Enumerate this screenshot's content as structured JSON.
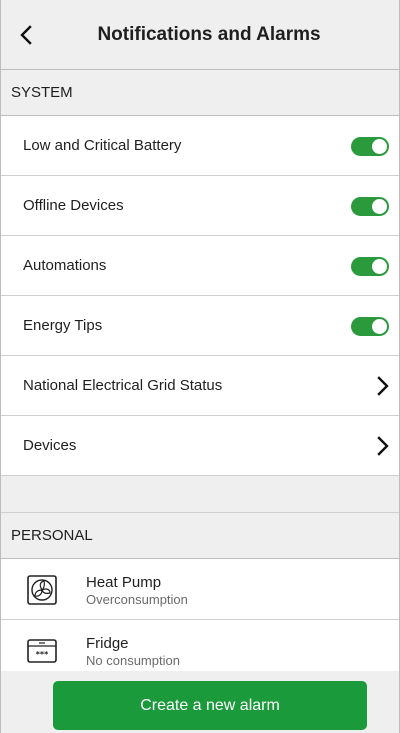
{
  "header": {
    "title": "Notifications and Alarms",
    "back_icon": "chevron-left-icon"
  },
  "system": {
    "heading": "SYSTEM",
    "toggles": [
      {
        "label": "Low and Critical Battery",
        "enabled": true
      },
      {
        "label": "Offline Devices",
        "enabled": true
      },
      {
        "label": "Automations",
        "enabled": true
      },
      {
        "label": "Energy Tips",
        "enabled": true
      }
    ],
    "links": [
      {
        "label": "National Electrical Grid Status",
        "icon": "chevron-right-icon"
      },
      {
        "label": "Devices",
        "icon": "chevron-right-icon"
      }
    ]
  },
  "personal": {
    "heading": "PERSONAL",
    "alarms": [
      {
        "name": "Heat Pump",
        "condition": "Overconsumption",
        "icon": "heat-pump-icon"
      },
      {
        "name": "Fridge",
        "condition": "No consumption",
        "icon": "fridge-icon"
      }
    ]
  },
  "footer": {
    "create_label": "Create a new alarm"
  },
  "colors": {
    "accent_green": "#1a9a3a",
    "toggle_green": "#2a9a3c",
    "section_bg": "#efefef"
  }
}
